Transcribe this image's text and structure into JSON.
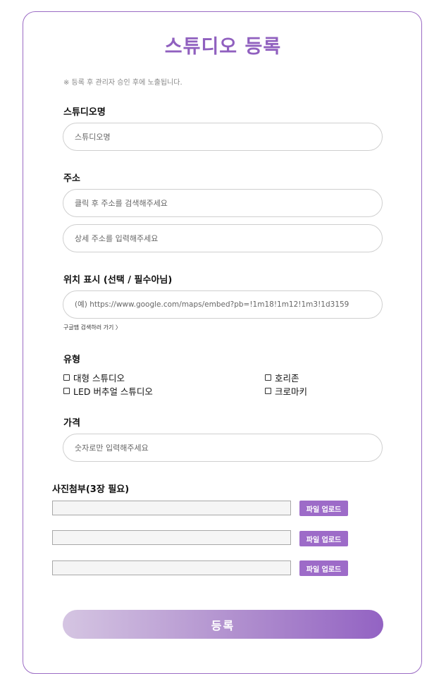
{
  "page": {
    "title": "스튜디오 등록",
    "notice": "※ 등록 후 관리자 승인 후에 노출됩니다."
  },
  "fields": {
    "studio_name": {
      "label": "스튜디오명",
      "placeholder": "스튜디오명"
    },
    "address": {
      "label": "주소",
      "search_placeholder": "클릭 후 주소를 검색해주세요",
      "detail_placeholder": "상세 주소를 입력해주세요"
    },
    "location": {
      "label": "위치 표시 (선택 / 필수아님)",
      "placeholder": "(예) https://www.google.com/maps/embed?pb=!1m18!1m12!1m3!1d3159",
      "link": "구글맵 검색하러 가기 〉"
    },
    "type": {
      "label": "유형",
      "options": [
        "대형 스튜디오",
        "호리존",
        "LED 버추얼 스튜디오",
        "크로마키"
      ]
    },
    "price": {
      "label": "가격",
      "placeholder": "숫자로만 입력해주세요"
    }
  },
  "photos": {
    "label": "사진첨부(3장 필요)",
    "upload_label": "파일 업로드"
  },
  "submit_label": "등록",
  "colors": {
    "accent": "#9060bf",
    "button": "#9d6bc8",
    "border": "#9b6bc4"
  }
}
